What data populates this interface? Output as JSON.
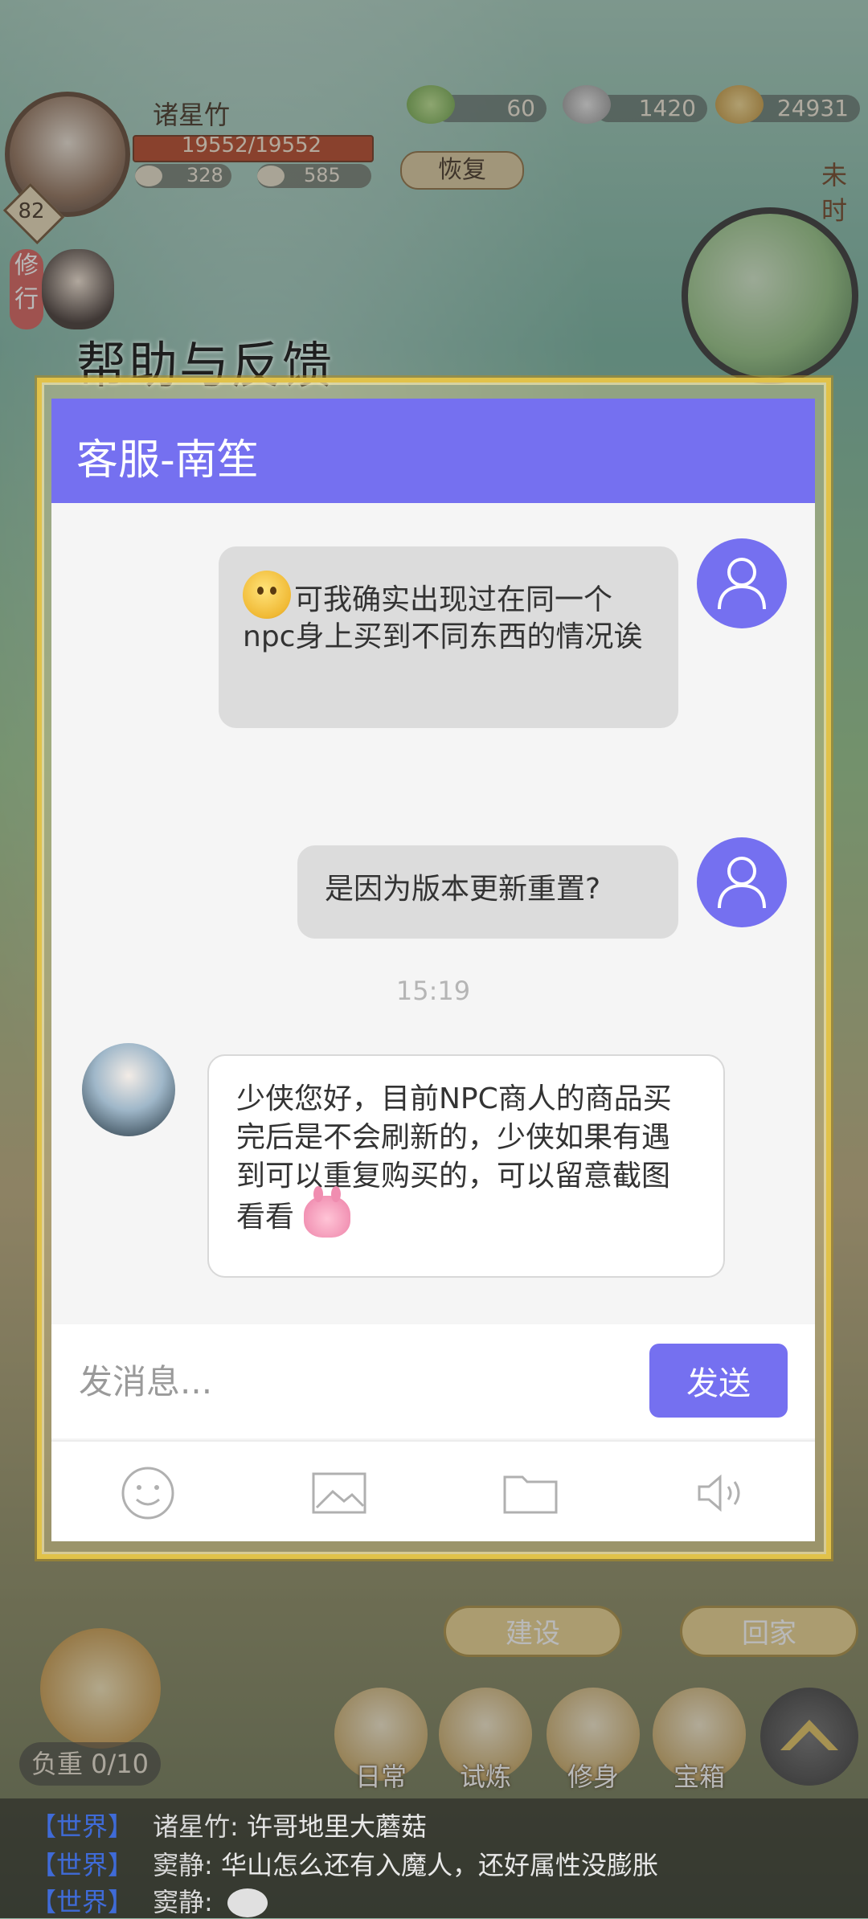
{
  "hud": {
    "player_name": "诸星竹",
    "hp": "19552/19552",
    "level": "82",
    "stat_a": "328",
    "stat_b": "585",
    "resource_1": "60",
    "resource_2": "1420",
    "resource_3": "24931",
    "recover_label": "恢复",
    "time_label": "未时",
    "side_badge": "修行"
  },
  "dialog": {
    "title": "帮助与反馈",
    "header": "客服-南笙",
    "messages": [
      {
        "from": "me",
        "text": "可我确实出现过在同一个npc身上买到不同东西的情况诶"
      },
      {
        "from": "me",
        "text": "是因为版本更新重置?"
      }
    ],
    "timestamp": "15:19",
    "agent_reply": "少侠您好，目前NPC商人的商品买完后是不会刷新的，少侠如果有遇到可以重复购买的，可以留意截图看看",
    "input_placeholder": "发消息...",
    "send_label": "发送",
    "accent_color": "#7570f0"
  },
  "game_ui": {
    "build_label": "建设",
    "home_label": "回家",
    "load_label": "负重 0/10",
    "nav": [
      "日常",
      "试炼",
      "修身",
      "宝箱"
    ]
  },
  "world_chat": [
    {
      "tag": "【世界】",
      "name": "诸星竹:",
      "text": "许哥地里大蘑菇"
    },
    {
      "tag": "【世界】",
      "name": "窦静:",
      "text": "华山怎么还有入魔人，还好属性没膨胀"
    },
    {
      "tag": "【世界】",
      "name": "窦静:",
      "text": ""
    }
  ]
}
